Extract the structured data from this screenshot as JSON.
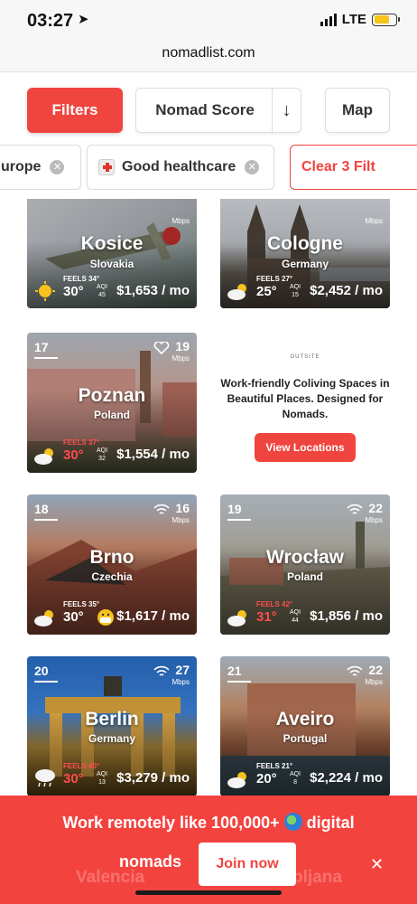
{
  "status": {
    "time": "03:27",
    "network": "LTE"
  },
  "browser": {
    "url": "nomadlist.com"
  },
  "controls": {
    "filters_label": "Filters",
    "sort_label": "Nomad Score",
    "sort_dir": "↓",
    "map_label": "Map"
  },
  "chips": {
    "europe": "urope",
    "healthcare": "Good healthcare",
    "clear": "Clear 3 Filt"
  },
  "cards": [
    {
      "rank": "",
      "speed": "",
      "mbps": "Mbps",
      "city": "Kosice",
      "country": "Slovakia",
      "feels": "FEELS 34°",
      "temp": "30°",
      "aqi": "45",
      "aqi_label": "AQI",
      "cost": "$1,653 / mo",
      "weather": "sun"
    },
    {
      "rank": "",
      "speed": "",
      "mbps": "Mbps",
      "city": "Cologne",
      "country": "Germany",
      "feels": "FEELS 27°",
      "temp": "25°",
      "aqi": "15",
      "aqi_label": "AQI",
      "cost": "$2,452 / mo",
      "weather": "cloud"
    },
    {
      "rank": "17",
      "speed": "19",
      "mbps": "Mbps",
      "city": "Poznan",
      "country": "Poland",
      "feels": "FEELS 37°",
      "temp": "30°",
      "aqi": "32",
      "aqi_label": "AQI",
      "cost": "$1,554 / mo",
      "weather": "cloud"
    },
    {
      "rank": "18",
      "speed": "16",
      "mbps": "Mbps",
      "city": "Brno",
      "country": "Czechia",
      "feels": "FEELS 35°",
      "temp": "30°",
      "aqi": "",
      "aqi_label": "",
      "cost": "$1,617 / mo",
      "weather": "cloud"
    },
    {
      "rank": "19",
      "speed": "22",
      "mbps": "Mbps",
      "city": "Wrocław",
      "country": "Poland",
      "feels": "FEELS 42°",
      "temp": "31°",
      "aqi": "44",
      "aqi_label": "AQI",
      "cost": "$1,856 / mo",
      "weather": "cloud"
    },
    {
      "rank": "20",
      "speed": "27",
      "mbps": "Mbps",
      "city": "Berlin",
      "country": "Germany",
      "feels": "FEELS 40°",
      "temp": "30°",
      "aqi": "13",
      "aqi_label": "AQI",
      "cost": "$3,279 / mo",
      "weather": "rain"
    },
    {
      "rank": "21",
      "speed": "22",
      "mbps": "Mbps",
      "city": "Aveiro",
      "country": "Portugal",
      "feels": "FEELS 21°",
      "temp": "20°",
      "aqi": "8",
      "aqi_label": "AQI",
      "cost": "$2,224 / mo",
      "weather": "cloud"
    }
  ],
  "promo": {
    "brand": "OUTSITE",
    "text": "Work-friendly Coliving Spaces in Beautiful Places. Designed for Nomads.",
    "button": "View Locations"
  },
  "banner": {
    "line1": "Work remotely like 100,000+",
    "line1_end": "digital",
    "line2": "nomads",
    "join": "Join now",
    "close": "✕",
    "ghost_left": "Valencia",
    "ghost_right": "bljana"
  },
  "colors": {
    "accent": "#f0443f",
    "hot": "#ff4d4d"
  }
}
